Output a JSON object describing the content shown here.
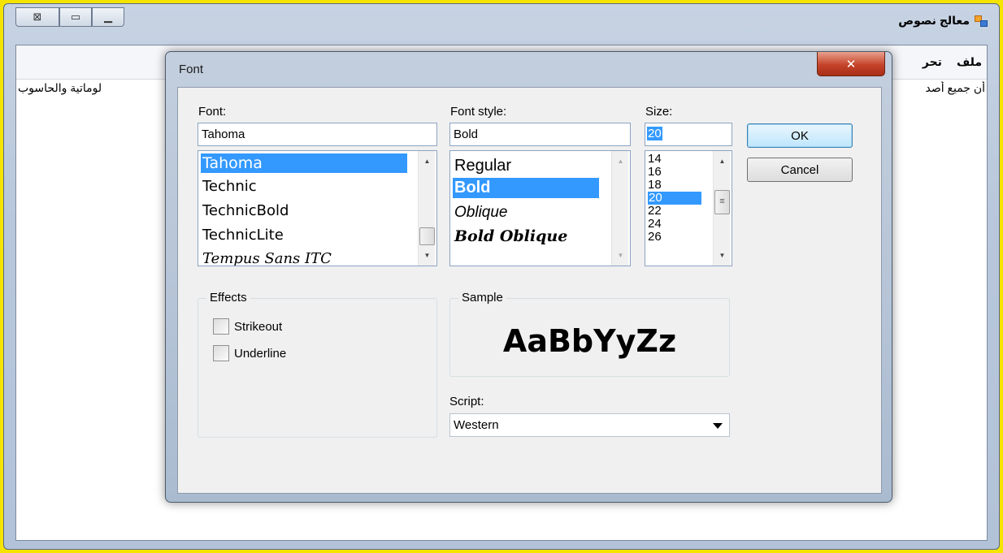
{
  "app": {
    "title": "معالج نصوص",
    "caption_buttons": {
      "close": "⊠",
      "restore": "▭",
      "minimize": "▁"
    }
  },
  "menu": {
    "items": [
      "ملف",
      "تحر"
    ]
  },
  "document": {
    "text_right": "أن جميع أصد",
    "text_left": "لوماتية والحاسوب"
  },
  "dialog": {
    "title": "Font",
    "close_glyph": "✕",
    "font_label": "Font:",
    "font_value": "Tahoma",
    "font_list": [
      "Tahoma",
      "Technic",
      "TechnicBold",
      "TechnicLite",
      "Tempus Sans ITC"
    ],
    "font_selected_index": 0,
    "style_label": "Font style:",
    "style_value": "Bold",
    "style_list": [
      "Regular",
      "Bold",
      "Oblique",
      "Bold Oblique"
    ],
    "style_selected_index": 1,
    "size_label": "Size:",
    "size_value": "20",
    "size_list": [
      "14",
      "16",
      "18",
      "20",
      "22",
      "24",
      "26"
    ],
    "size_selected_index": 3,
    "ok_label": "OK",
    "cancel_label": "Cancel",
    "effects_label": "Effects",
    "strikeout_label": "Strikeout",
    "underline_label": "Underline",
    "sample_label": "Sample",
    "sample_text": "AaBbYyZz",
    "script_label": "Script:",
    "script_value": "Western"
  },
  "colors": {
    "background": "#f5e400",
    "selection": "#3399ff",
    "close_button": "#c4432a"
  }
}
